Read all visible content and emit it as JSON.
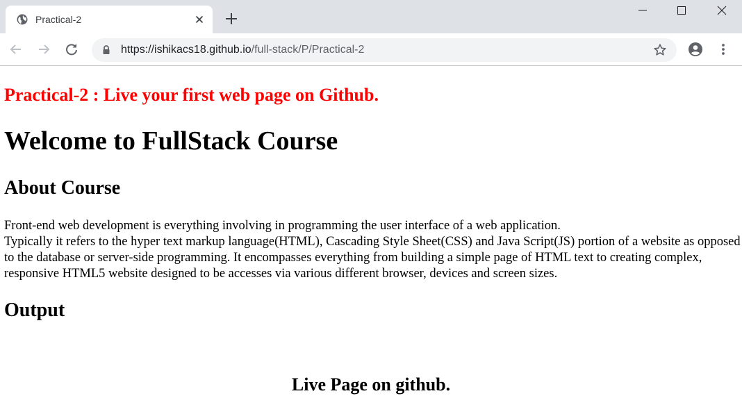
{
  "browser": {
    "tab": {
      "title": "Practical-2",
      "favicon": "globe-icon"
    },
    "address_bar": {
      "host": "https://ishikacs18.github.io",
      "path": "/full-stack/P/Practical-2"
    },
    "icons": {
      "back": "back-arrow-icon",
      "forward": "forward-arrow-icon",
      "reload": "reload-icon",
      "lock": "lock-icon",
      "bookmark": "star-icon",
      "profile": "account-circle-icon",
      "menu": "more-vert-icon",
      "new_tab": "plus-icon",
      "tab_close": "close-icon",
      "minimize": "minimize-icon",
      "maximize": "maximize-icon",
      "close_window": "close-icon"
    },
    "colors": {
      "tabstrip": "#dee1e6",
      "omnibox": "#f1f3f4"
    }
  },
  "page": {
    "practical_heading": "Practical-2 : Live your first web page on Github.",
    "welcome_heading": "Welcome to FullStack Course",
    "about_heading": "About Course",
    "about_line1": "Front-end web development is everything involving in programming the user interface of a web application.",
    "about_line2": "Typically it refers to the hyper text markup language(HTML), Cascading Style Sheet(CSS) and Java Script(JS) portion of a website as opposed to the database or server-side programming. It encompasses everything from building a simple page of HTML text to creating complex, responsive HTML5 website designed to be accesses via various different browser, devices and screen sizes.",
    "output_heading": "Output",
    "live_heading": "Live Page on github.",
    "colors": {
      "practical_heading": "#ff0000",
      "text": "#000000"
    }
  }
}
